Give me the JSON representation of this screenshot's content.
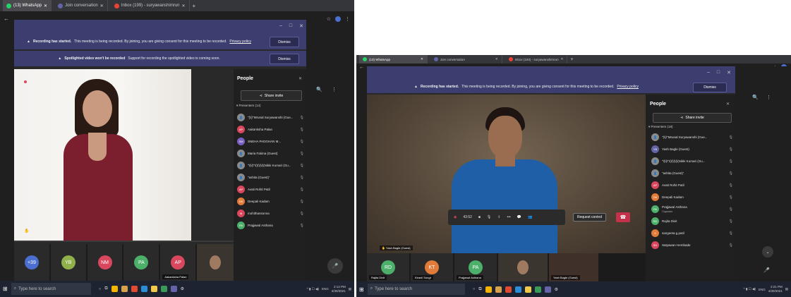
{
  "left": {
    "tabs": [
      {
        "label": "(13) WhatsApp",
        "color": "#25d366"
      },
      {
        "label": "Join conversation",
        "color": "#6264a7"
      },
      {
        "label": "Inbox (199) - suryawanshimrun",
        "color": "#ea4335"
      }
    ],
    "window_min": "–",
    "window_max": "□",
    "window_close": "✕",
    "banner1": {
      "bold": "Recording has started.",
      "text": "This meeting is being recorded. By joining, you are giving consent for this meeting to be recorded.",
      "link": "Privacy policy",
      "dismiss": "Dismiss"
    },
    "banner2": {
      "bold": "Spotlighted video won't be recorded",
      "text": "Support for recording the spotlighted video is coming soon.",
      "dismiss": "Dismiss"
    },
    "people": {
      "title": "People",
      "share_invite": "Share invite",
      "presenters": "Presenters (14)",
      "list": [
        {
          "initials": "",
          "name": "\"(\\(\\\"Mrunal Suryawanshi (Gue...",
          "color": "#8a8a8a"
        },
        {
          "initials": "AP",
          "name": "Aakanksha Palan",
          "color": "#d9475e"
        },
        {
          "initials": "SM",
          "name": "SNEHA PADGHAN M...",
          "color": "#7a5fc2"
        },
        {
          "initials": "",
          "name": "Maria Fatima (Guest)",
          "color": "#8a8a8a"
        },
        {
          "initials": "",
          "name": "\"\\(\\(\\\"\\(\\(\\(\\(\\(Nikki Kumari (Gu...",
          "color": "#8a8a8a"
        },
        {
          "initials": "",
          "name": "\"ashita (Guest)\"",
          "color": "#8a8a8a"
        },
        {
          "initials": "AP",
          "name": "Avati Rohit Patil",
          "color": "#d9475e"
        },
        {
          "initials": "DK",
          "name": "Deepali Kadam",
          "color": "#e07b39"
        },
        {
          "initials": "M",
          "name": "mohithansonna",
          "color": "#d9475e"
        },
        {
          "initials": "PA",
          "name": "Prajjawal Asthana",
          "color": "#4caf6a"
        }
      ]
    },
    "thumbs": [
      {
        "initials": "+39",
        "color": "#4a6fd0"
      },
      {
        "initials": "YB",
        "color": "#8fb04a"
      },
      {
        "initials": "NM",
        "color": "#d9475e"
      },
      {
        "initials": "PA",
        "color": "#4caf6a"
      },
      {
        "initials": "AP",
        "color": "#d9475e",
        "label": "Aakanksha Palan"
      }
    ],
    "taskbar": {
      "search": "Type here to search",
      "time": "2:14 PM",
      "date": "4/30/2021",
      "lang": "ENG"
    }
  },
  "right": {
    "tabs": [
      {
        "label": "(13) WhatsApp",
        "color": "#25d366"
      },
      {
        "label": "Join conversation",
        "color": "#6264a7"
      },
      {
        "label": "Inbox (194) - suryawanshimrun",
        "color": "#ea4335"
      }
    ],
    "window_min": "–",
    "window_max": "□",
    "window_close": "✕",
    "banner1": {
      "bold": "Recording has started.",
      "text": "This meeting is being recorded. By joining, you are giving consent for this meeting to be recorded.",
      "link": "Privacy policy",
      "dismiss": "Dismiss"
    },
    "speaker_label": "Yash Bagle (Guest)",
    "controls": {
      "timer": "43:52",
      "request": "Request control"
    },
    "people": {
      "title": "People",
      "share_invite": "Share invite",
      "presenters": "Presenters (18)",
      "list": [
        {
          "initials": "",
          "name": "\"(\\(\\\"Mrunal Suryawanshi (Gue...",
          "color": "#8a8a8a",
          "sub": ""
        },
        {
          "initials": "YB",
          "name": "Yash Bagle (Guest)",
          "color": "#6264a7",
          "sub": ""
        },
        {
          "initials": "",
          "name": "\"\\(\\(\\\"\\(\\(\\(\\(\\(Nikki Kumari (Gu...",
          "color": "#8a8a8a",
          "sub": ""
        },
        {
          "initials": "",
          "name": "\"ashita (Guest)\"",
          "color": "#8a8a8a",
          "sub": ""
        },
        {
          "initials": "AP",
          "name": "Avati Rohit Patil",
          "color": "#d9475e",
          "sub": ""
        },
        {
          "initials": "DK",
          "name": "Deepali Kadam",
          "color": "#e07b39",
          "sub": ""
        },
        {
          "initials": "PA",
          "name": "Prajjawal Asthana",
          "color": "#4caf6a",
          "sub": "Organizer"
        },
        {
          "initials": "RD",
          "name": "Rajita Dixit",
          "color": "#4caf6a",
          "sub": ""
        },
        {
          "initials": "S",
          "name": "sangeeta.g.patil",
          "color": "#e07b39",
          "sub": ""
        },
        {
          "initials": "SH",
          "name": "Satyawan Hembade",
          "color": "#d9475e",
          "sub": ""
        }
      ]
    },
    "thumbs": [
      {
        "initials": "RD",
        "color": "#4caf6a",
        "label": "Rajita Dixit"
      },
      {
        "initials": "KT",
        "color": "#e07b39",
        "label": "Kiranli Songt"
      },
      {
        "initials": "PA",
        "color": "#4caf6a",
        "label": "Prajjawal Asthana"
      }
    ],
    "thumb_label_guest": "Yash Bagle (Guest)",
    "taskbar": {
      "search": "Type here to search",
      "time": "2:21 PM",
      "date": "4/30/2021",
      "lang": "ENG"
    }
  }
}
